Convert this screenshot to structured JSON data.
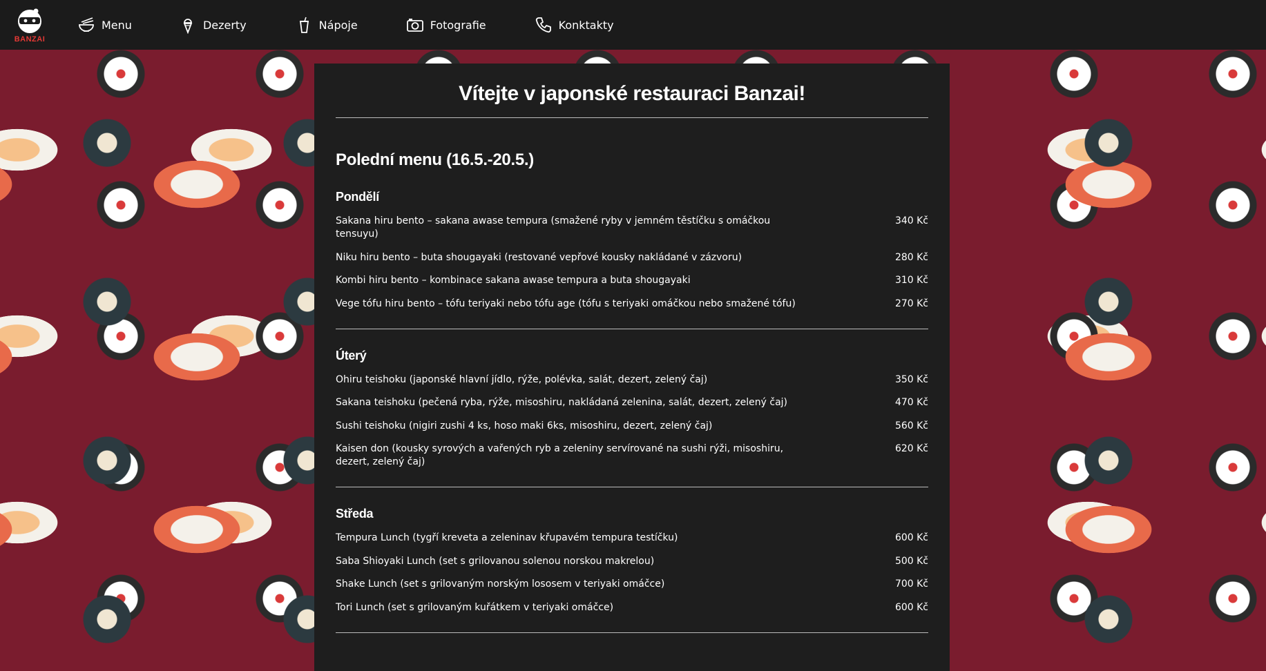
{
  "nav": {
    "logo_text": "BANZAI",
    "items": [
      {
        "label": "Menu",
        "icon": "bowl-icon"
      },
      {
        "label": "Dezerty",
        "icon": "ice-cream-icon"
      },
      {
        "label": "Nápoje",
        "icon": "drink-cup-icon"
      },
      {
        "label": "Fotografie",
        "icon": "camera-icon"
      },
      {
        "label": "Konktakty",
        "icon": "phone-icon"
      }
    ]
  },
  "page": {
    "welcome": "Vítejte v japonské restauraci Banzai!",
    "menu_title": "Polední menu (16.5.-20.5.)"
  },
  "days": [
    {
      "name": "Pondělí",
      "items": [
        {
          "name": "Sakana hiru bento – sakana awase tempura (smažené ryby v jemném těstíčku s omáčkou tensuyu)",
          "price": "340 Kč"
        },
        {
          "name": "Niku hiru bento – buta shougayaki (restované vepřové kousky nakládané v zázvoru)",
          "price": "280 Kč"
        },
        {
          "name": "Kombi hiru bento – kombinace sakana awase tempura a buta shougayaki",
          "price": "310 Kč"
        },
        {
          "name": "Vege tófu hiru bento – tófu teriyaki nebo tófu age (tófu s teriyaki omáčkou nebo smažené tófu)",
          "price": "270 Kč"
        }
      ]
    },
    {
      "name": "Úterý",
      "items": [
        {
          "name": "Ohiru teishoku (japonské hlavní jídlo, rýže, polévka, salát, dezert, zelený čaj)",
          "price": "350 Kč"
        },
        {
          "name": "Sakana teishoku (pečená ryba, rýže, misoshiru, nakládaná zelenina, salát, dezert, zelený čaj)",
          "price": "470 Kč"
        },
        {
          "name": "Sushi teishoku (nigiri zushi 4 ks, hoso maki 6ks, misoshiru, dezert, zelený čaj)",
          "price": "560 Kč"
        },
        {
          "name": "Kaisen don (kousky syrových a vařených ryb a zeleniny servírované na sushi rýži, misoshiru, dezert, zelený čaj)",
          "price": "620 Kč"
        }
      ]
    },
    {
      "name": "Středa",
      "items": [
        {
          "name": "Tempura Lunch (tygří kreveta a zeleninav křupavém tempura testíčku)",
          "price": "600 Kč"
        },
        {
          "name": "Saba Shioyaki Lunch (set s grilovanou solenou norskou makrelou)",
          "price": "500 Kč"
        },
        {
          "name": "Shake Lunch (set s grilovaným norským lososem v teriyaki omáčce)",
          "price": "700 Kč"
        },
        {
          "name": "Tori Lunch (set s grilovaným kuřátkem v teriyaki omáčce)",
          "price": "600 Kč"
        }
      ]
    }
  ],
  "colors": {
    "navbar": "#1b1b1b",
    "panel": "#1e1e1e",
    "background": "#7a1c2e",
    "logo_accent": "#e53935"
  }
}
